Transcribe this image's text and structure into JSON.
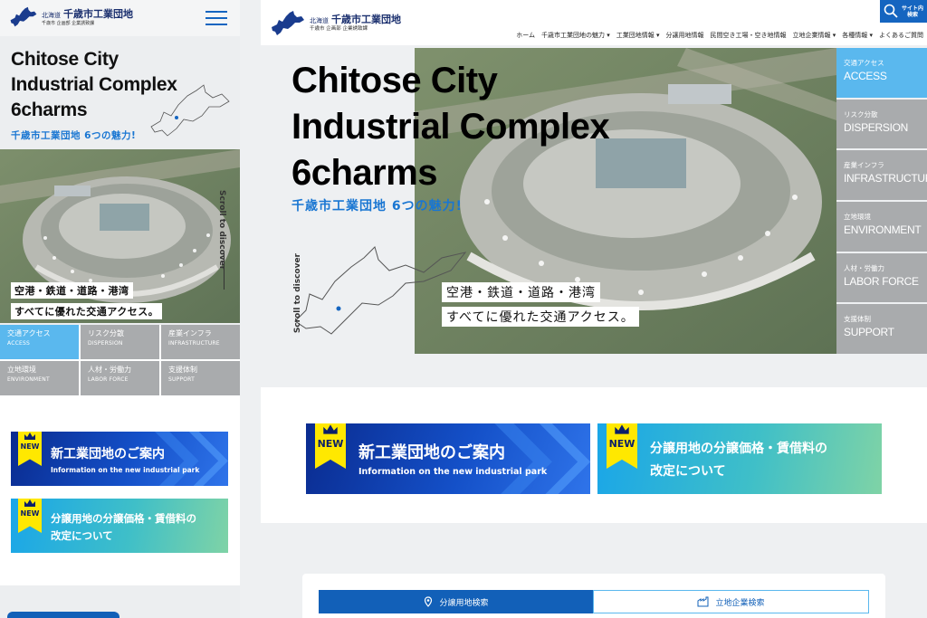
{
  "logo": {
    "prefix": "北海道",
    "name": "千歳市工業団地",
    "sub": "千歳市 企画部 企業誘致課"
  },
  "hero": {
    "title_lines": [
      "Chitose City",
      "Industrial Complex",
      "6charms"
    ],
    "subtitle": "千歳市工業団地 6つの魅力!",
    "scroll_label": "Scroll to discover",
    "catch_lines": [
      "空港・鉄道・道路・港湾",
      "すべてに優れた交通アクセス。"
    ]
  },
  "charms": [
    {
      "jp": "交通アクセス",
      "en": "ACCESS"
    },
    {
      "jp": "リスク分散",
      "en": "DISPERSION"
    },
    {
      "jp": "産業インフラ",
      "en": "INFRASTRUCTURE"
    },
    {
      "jp": "立地環境",
      "en": "ENVIRONMENT"
    },
    {
      "jp": "人材・労働力",
      "en": "LABOR FORCE"
    },
    {
      "jp": "支援体制",
      "en": "SUPPORT"
    }
  ],
  "nav": [
    "ホーム",
    "千歳市工業団地の魅力",
    "工業団地情報",
    "分譲用地情報",
    "民間空き工場・空き地情報",
    "立地企業情報",
    "各種情報",
    "よくあるご質問"
  ],
  "search": {
    "label_line1": "サイト内",
    "label_line2": "検索"
  },
  "banners": {
    "badge": "NEW",
    "new_park_title": "新工業団地のご案内",
    "new_park_sub": "Information on the new industrial park",
    "price_line1": "分譲用地の分譲価格・賃借料の",
    "price_line2": "改定について"
  },
  "tabs": {
    "land_search": "分譲用地検索",
    "company_search": "立地企業検索"
  },
  "colors": {
    "accent": "#1565c0",
    "active_tab": "#5ab8ee",
    "inactive_tab": "#a9abad",
    "badge": "#ffe800"
  }
}
